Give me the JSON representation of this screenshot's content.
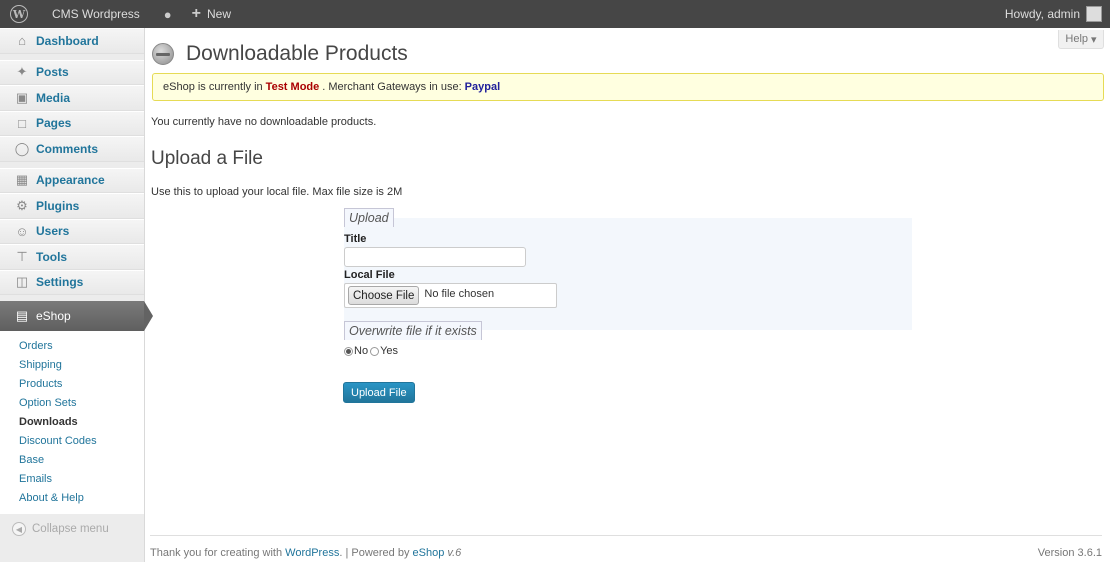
{
  "adminbar": {
    "site_name": "CMS Wordpress",
    "new_label": "New",
    "howdy": "Howdy, admin"
  },
  "help": {
    "label": "Help"
  },
  "sidebar": {
    "items": [
      {
        "label": "Dashboard",
        "icon": "house-icon"
      },
      {
        "label": "Posts",
        "icon": "pin-icon"
      },
      {
        "label": "Media",
        "icon": "media-icon"
      },
      {
        "label": "Pages",
        "icon": "pages-icon"
      },
      {
        "label": "Comments",
        "icon": "comment-icon"
      },
      {
        "label": "Appearance",
        "icon": "appearance-icon"
      },
      {
        "label": "Plugins",
        "icon": "plug-icon"
      },
      {
        "label": "Users",
        "icon": "users-icon"
      },
      {
        "label": "Tools",
        "icon": "tools-icon"
      },
      {
        "label": "Settings",
        "icon": "settings-icon"
      }
    ],
    "current": {
      "label": "eShop",
      "icon": "eshop-icon"
    },
    "submenu": [
      "Orders",
      "Shipping",
      "Products",
      "Option Sets",
      "Downloads",
      "Discount Codes",
      "Base",
      "Emails",
      "About & Help"
    ],
    "submenu_active": "Downloads",
    "collapse": "Collapse menu"
  },
  "main": {
    "title": "Downloadable Products",
    "notice": {
      "prefix": "eShop is currently in",
      "mode": "Test Mode",
      "middle": ". Merchant Gateways in use:",
      "gateway": "Paypal"
    },
    "no_products": "You currently have no downloadable products.",
    "section_title": "Upload a File",
    "upload_info": "Use this to upload your local file. Max file size is 2M",
    "form": {
      "legend_upload": "Upload",
      "title_label": "Title",
      "title_value": "",
      "file_label": "Local File",
      "choose_button": "Choose File",
      "no_file": "No file chosen",
      "legend_overwrite": "Overwrite file if it exists",
      "radio_no": "No",
      "radio_yes": "Yes",
      "radio_selected": "No",
      "submit": "Upload File"
    }
  },
  "footer": {
    "thanks_prefix": "Thank you for creating with",
    "wordpress": "WordPress",
    "powered": ". | Powered by",
    "eshop": "eShop",
    "eshop_ver": "v.6",
    "version": "Version 3.6.1"
  },
  "colors": {
    "link": "#21759b",
    "adminbar": "#464646",
    "notice_bg": "#ffffe0",
    "test_mode": "#aa0000",
    "button": "#21759b"
  }
}
